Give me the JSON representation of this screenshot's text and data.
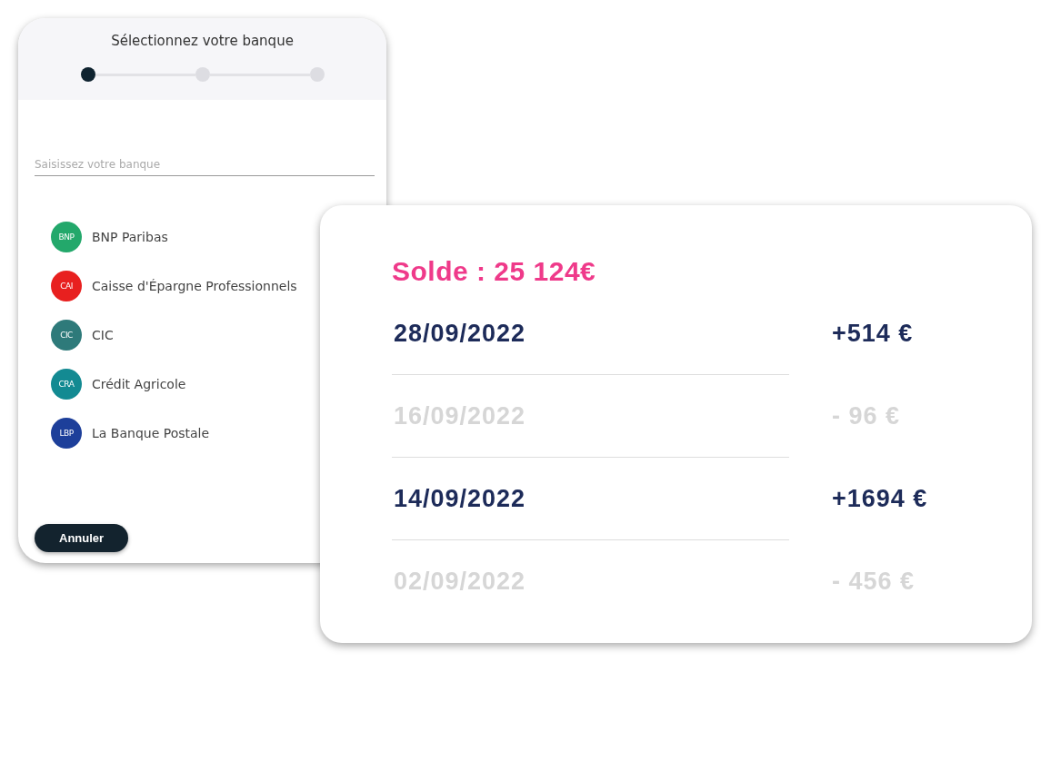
{
  "bank_picker": {
    "title": "Sélectionnez votre banque",
    "steps": [
      {
        "active": true
      },
      {
        "active": false
      },
      {
        "active": false
      }
    ],
    "search": {
      "placeholder": "Saisissez votre banque"
    },
    "banks": [
      {
        "abbr": "BNP",
        "name": "BNP Paribas",
        "color": "#23a86b"
      },
      {
        "abbr": "CAI",
        "name": "Caisse d'Épargne Professionnels",
        "color": "#e8201f"
      },
      {
        "abbr": "CIC",
        "name": "CIC",
        "color": "#2e7a7a"
      },
      {
        "abbr": "CRA",
        "name": "Crédit Agricole",
        "color": "#138a92"
      },
      {
        "abbr": "LBP",
        "name": "La Banque Postale",
        "color": "#1d3f9a"
      }
    ],
    "cancel_button": "Annuler"
  },
  "balance_card": {
    "balance": "Solde : 25 124€",
    "transactions": [
      {
        "date": "28/09/2022",
        "amount": "+514 €",
        "faded": false
      },
      {
        "date": "16/09/2022",
        "amount": "- 96 €",
        "faded": true
      },
      {
        "date": "14/09/2022",
        "amount": "+1694 €",
        "faded": false
      },
      {
        "date": "02/09/2022",
        "amount": "- 456 €",
        "faded": true
      }
    ]
  }
}
